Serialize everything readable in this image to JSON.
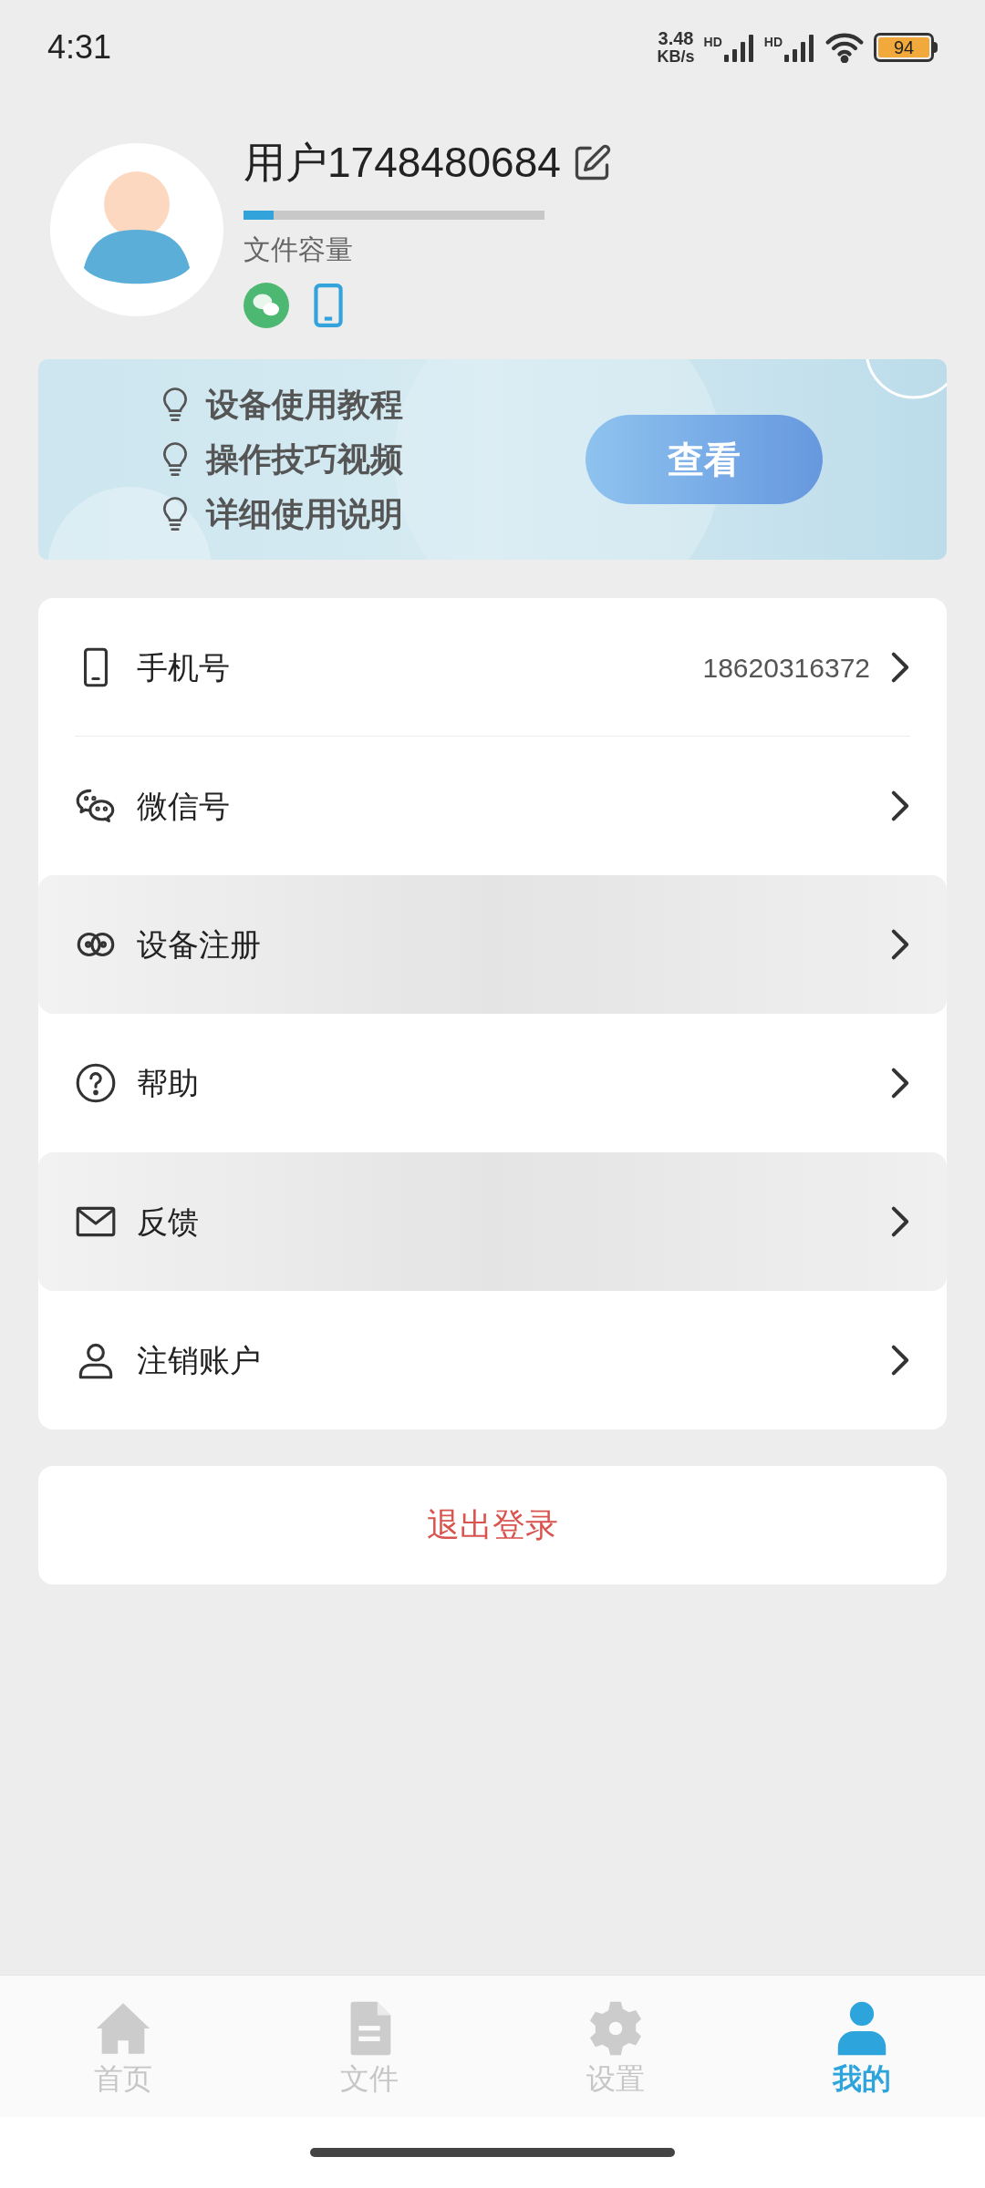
{
  "status_bar": {
    "time": "4:31",
    "speed": "3.48",
    "speed_unit": "KB/s",
    "sim_labels": [
      "HD",
      "HD"
    ],
    "battery": "94"
  },
  "profile": {
    "username": "用户1748480684",
    "storage": {
      "level": 0.1,
      "label": "文件容量"
    }
  },
  "banner": {
    "items": [
      "设备使用教程",
      "操作技巧视频",
      "详细使用说明"
    ],
    "button": "查看"
  },
  "menu": [
    {
      "kind": "phone",
      "label": "手机号",
      "value": "18620316372",
      "highlighted": false
    },
    {
      "kind": "wechat",
      "label": "微信号",
      "highlighted": false
    },
    {
      "kind": "link",
      "label": "设备注册",
      "highlighted": true
    },
    {
      "kind": "help",
      "label": "帮助",
      "highlighted": false
    },
    {
      "kind": "mail",
      "label": "反馈",
      "highlighted": true
    },
    {
      "kind": "user",
      "label": "注销账户",
      "highlighted": false
    }
  ],
  "logout": "退出登录",
  "tabs": [
    {
      "kind": "home",
      "label": "首页",
      "selected": false
    },
    {
      "kind": "file",
      "label": "文件",
      "selected": false
    },
    {
      "kind": "settings",
      "label": "设置",
      "selected": false
    },
    {
      "kind": "me",
      "label": "我的",
      "selected": true
    }
  ]
}
